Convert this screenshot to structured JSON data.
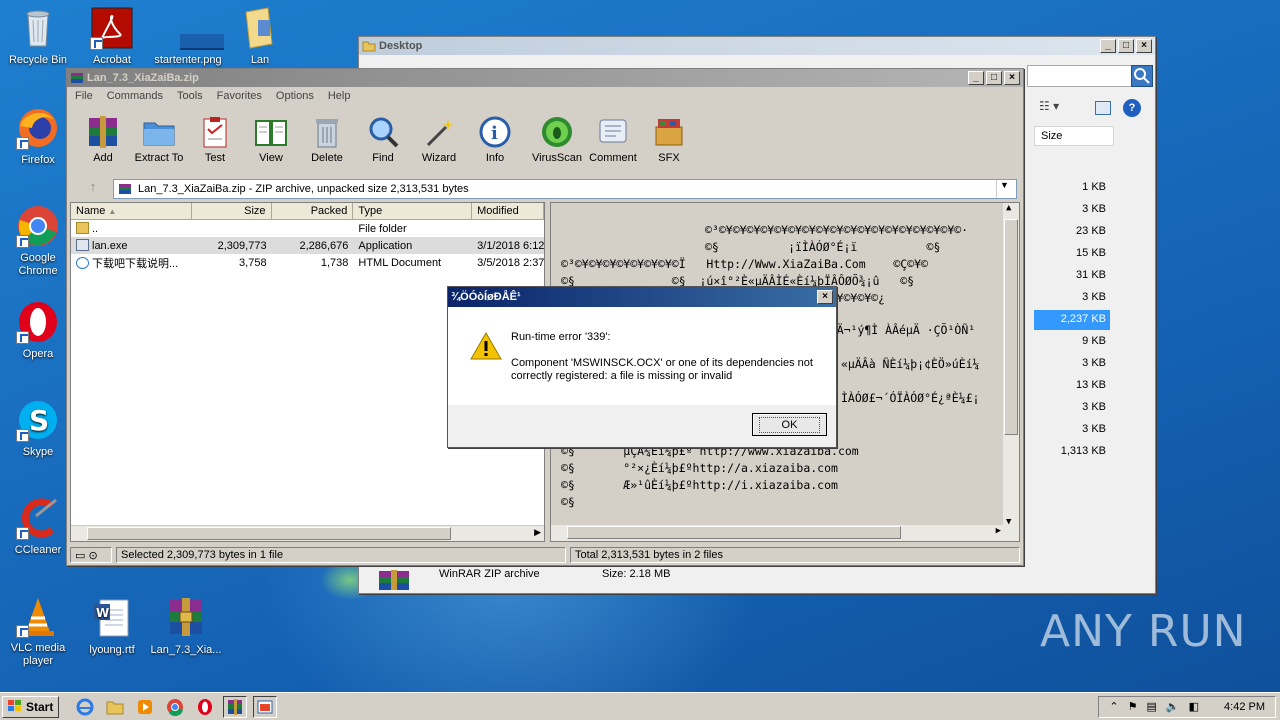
{
  "desktop_icons": [
    {
      "label": "Recycle Bin"
    },
    {
      "label": "Acrobat"
    },
    {
      "label": "startenter.png"
    },
    {
      "label": "Lan"
    },
    {
      "label": "Firefox"
    },
    {
      "label": "Google Chrome"
    },
    {
      "label": "Opera"
    },
    {
      "label": "Skype"
    },
    {
      "label": "CCleaner"
    },
    {
      "label": "VLC media player"
    },
    {
      "label": "lyoung.rtf"
    },
    {
      "label": "Lan_7.3_Xia..."
    }
  ],
  "explorer": {
    "title": "Desktop",
    "col_size": "Size",
    "sizes": [
      "1 KB",
      "3 KB",
      "23 KB",
      "15 KB",
      "31 KB",
      "3 KB",
      "2,237 KB",
      "9 KB",
      "3 KB",
      "13 KB",
      "3 KB",
      "3 KB",
      "1,313 KB"
    ],
    "footer_type": "WinRAR ZIP archive",
    "footer_size": "Size: 2.18 MB"
  },
  "rar": {
    "title": "Lan_7.3_XiaZaiBa.zip",
    "menu": [
      "File",
      "Commands",
      "Tools",
      "Favorites",
      "Options",
      "Help"
    ],
    "tools": [
      {
        "label": "Add",
        "icon": "rar-books-icon"
      },
      {
        "label": "Extract To",
        "icon": "folder-icon"
      },
      {
        "label": "Test",
        "icon": "clipboard-icon"
      },
      {
        "label": "View",
        "icon": "book-icon"
      },
      {
        "label": "Delete",
        "icon": "trash-icon"
      },
      {
        "label": "Find",
        "icon": "magnifier-icon"
      },
      {
        "label": "Wizard",
        "icon": "wand-icon"
      },
      {
        "label": "Info",
        "icon": "info-icon"
      },
      {
        "label": "VirusScan",
        "icon": "bug-icon"
      },
      {
        "label": "Comment",
        "icon": "comment-icon"
      },
      {
        "label": "SFX",
        "icon": "box-icon"
      }
    ],
    "address": "Lan_7.3_XiaZaiBa.zip - ZIP archive, unpacked size 2,313,531 bytes",
    "columns": {
      "name": "Name",
      "size": "Size",
      "packed": "Packed",
      "type": "Type",
      "modified": "Modified"
    },
    "rows": [
      {
        "name": "..",
        "size": "",
        "packed": "",
        "type": "File folder",
        "modified": ""
      },
      {
        "name": "lan.exe",
        "size": "2,309,773",
        "packed": "2,286,676",
        "type": "Application",
        "modified": "3/1/2018 6:12"
      },
      {
        "name": "下载吧下载说明...",
        "size": "3,758",
        "packed": "1,738",
        "type": "HTML Document",
        "modified": "3/5/2018 2:37"
      }
    ],
    "preview_lines": [
      "©³©¥©¥©¥©¥©¥©¥©¥©¥©¥©¥©¥©¥©¥©¥©¥©¥©¥©·",
      "©§          ¡ïÌÀÓØ°É¡ï          ©§",
      "©³©¥©¥©¥©¥©¥©¥©¥©Ï   Http://Www.XiaZaiBa.Com    ©Ç©¥©",
      "©§              ©§  ¡ú×î°²È«µÄÂÌÉ«Èí¼þÏÂÔØÕ¾¡û   ©§",
      "©¥©¥©¥©¥©¥©¥©¥©¥©¥©¥©¥©¥©¿",
      "Ä¾£¬Ä¬¹ý¶Ì ÀÂéµÄ ·ÇÕ¹ÒÑ¹",
      "«µÄÂà ÑÈí¼þ¡¢ÈÖ»úÈí¼",
      "ÌÀÓØ£¬´ÓÏÀÓØ°É¿ªÈ¼£¡",
      "©§       µÇÂ¼Èí¼þ£º http://www.xiazaiba.com",
      "©§       °²×¿Èí¼þ£ºhttp://a.xiazaiba.com",
      "©§       Æ»¹ûÈí¼þ£ºhttp://i.xiazaiba.com",
      "©§"
    ],
    "status_left": "Selected 2,309,773 bytes in 1 file",
    "status_right": "Total 2,313,531 bytes in 2 files"
  },
  "dialog": {
    "title": "¾ÖÓòÍøÐÅÊ¹",
    "line1": "Run-time error '339':",
    "line2": "Component 'MSWINSCK.OCX' or one of its dependencies not correctly registered: a file is missing or invalid",
    "ok": "OK"
  },
  "taskbar": {
    "start": "Start",
    "clock": "4:42 PM"
  },
  "watermark": "ANY RUN"
}
